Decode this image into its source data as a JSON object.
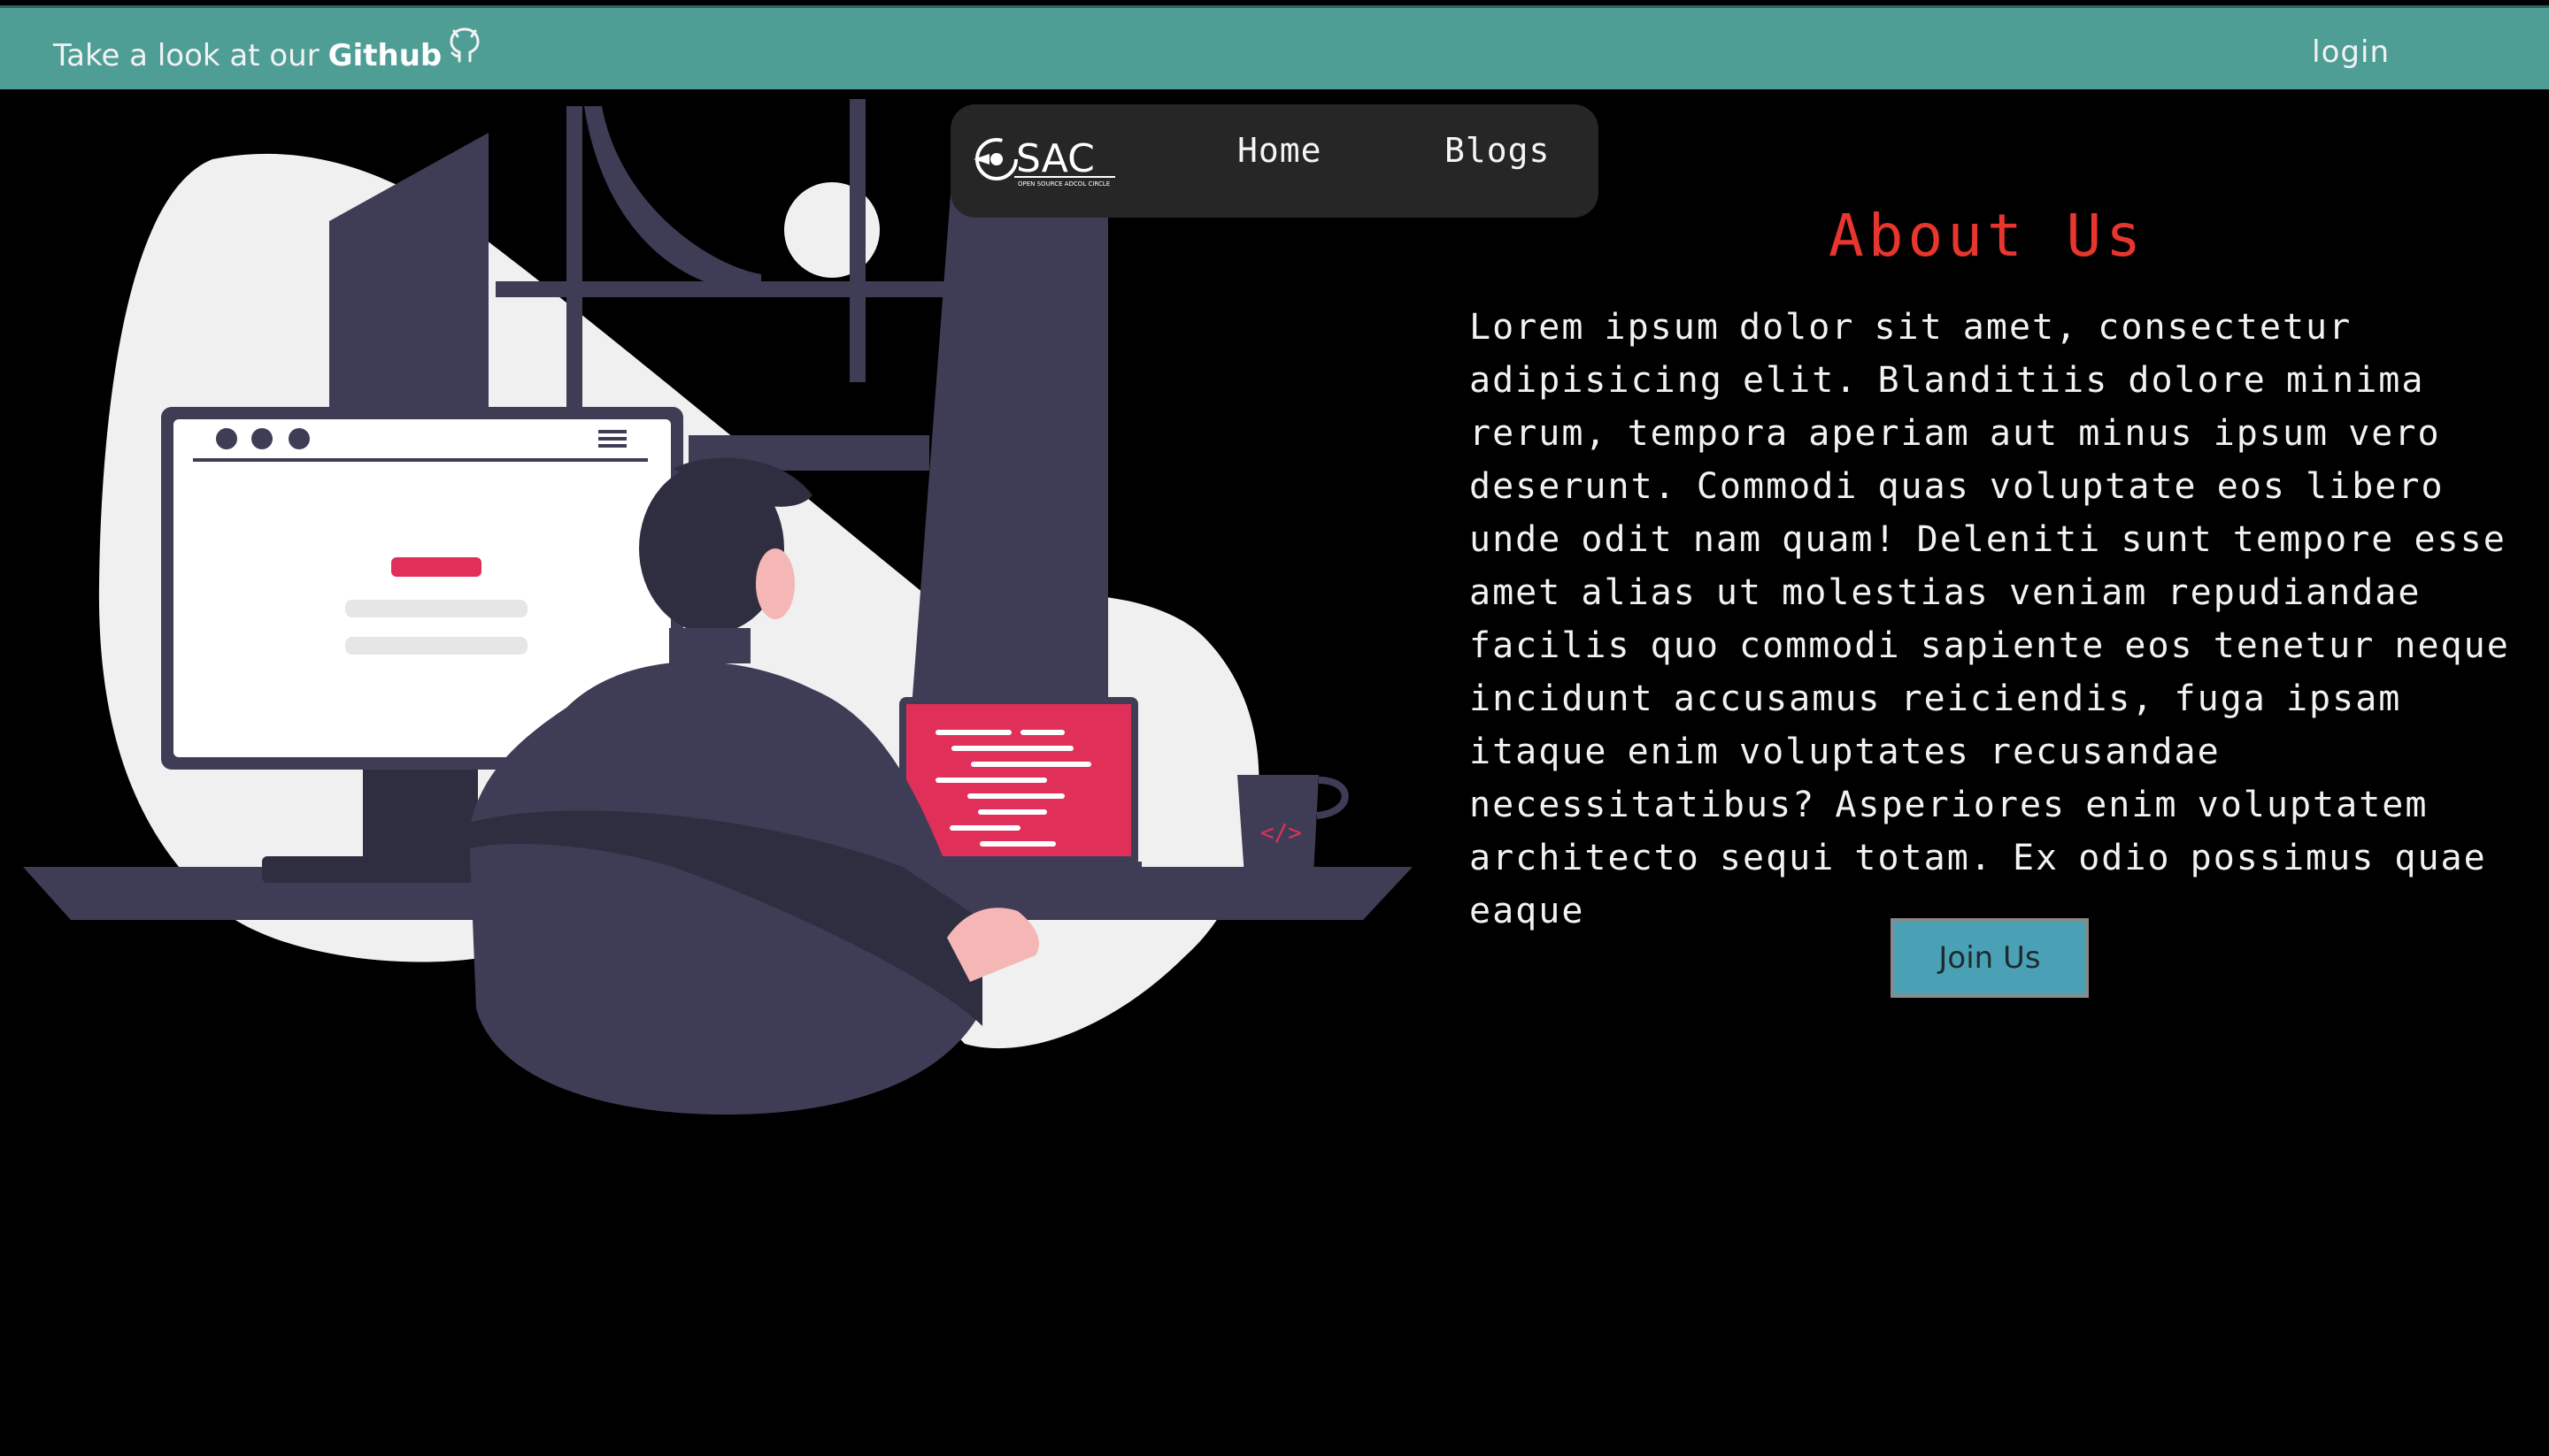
{
  "topbar": {
    "prefix": "Take a look at our",
    "github_link": "Github",
    "github_icon": "github-icon",
    "login": "login"
  },
  "nav": {
    "logo_text": "SAC",
    "logo_tagline": "OPEN SOURCE ADCOL CIRCLE",
    "home": "Home",
    "blogs": "Blogs"
  },
  "about": {
    "title": "About Us",
    "body": "Lorem ipsum dolor sit amet, consectetur adipisicing elit. Blanditiis dolore minima rerum, tempora aperiam aut minus ipsum vero deserunt. Commodi quas voluptate eos libero unde odit nam quam! Deleniti sunt tempore esse amet alias ut molestias veniam repudiandae facilis quo commodi sapiente eos tenetur neque incidunt accusamus reiciendis, fuga ipsam itaque enim voluptates recusandae necessitatibus? Asperiores enim voluptatem architecto sequi totam. Ex odio possimus quae eaque",
    "join_button": "Join Us"
  },
  "colors": {
    "topbar": "#4f9e96",
    "title": "#e8362f",
    "button": "#4aa1b6",
    "accent_pink": "#e0305a",
    "figure_dark": "#3f3d56"
  }
}
